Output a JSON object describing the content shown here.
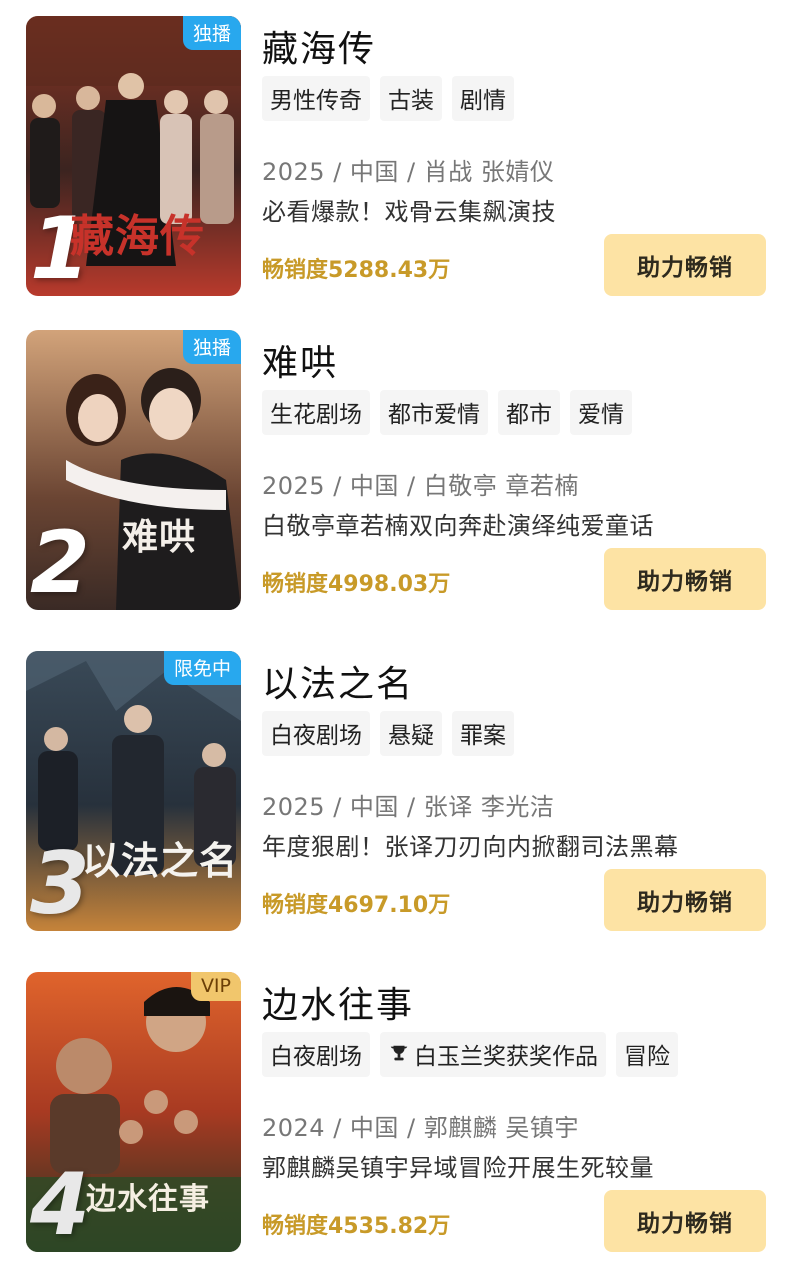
{
  "items": [
    {
      "rank": "1",
      "badge": "独播",
      "poster_title": "藏海传",
      "title": "藏海传",
      "tags": [
        "男性传奇",
        "古装",
        "剧情"
      ],
      "meta": "2025 / 中国 / 肖战 张婧仪",
      "desc": "必看爆款！戏骨云集飙演技",
      "sales": "畅销度5288.43万",
      "button": "助力畅销",
      "colors": {
        "bg_top": "#7b2f1f",
        "bg_bottom": "#3a1c14"
      }
    },
    {
      "rank": "2",
      "badge": "独播",
      "poster_title": "难哄",
      "title": "难哄",
      "tags": [
        "生花剧场",
        "都市爱情",
        "都市",
        "爱情"
      ],
      "meta": "2025 / 中国 / 白敬亭 章若楠",
      "desc": "白敬亭章若楠双向奔赴演绎纯爱童话",
      "sales": "畅销度4998.03万",
      "button": "助力畅销",
      "colors": {
        "bg_top": "#c49570",
        "bg_bottom": "#4b3026"
      }
    },
    {
      "rank": "3",
      "badge": "限免中",
      "poster_title": "以法之名",
      "title": "以法之名",
      "tags": [
        "白夜剧场",
        "悬疑",
        "罪案"
      ],
      "meta": "2025 / 中国 / 张译 李光洁",
      "desc": "年度狠剧！张译刀刃向内掀翻司法黑幕",
      "sales": "畅销度4697.10万",
      "button": "助力畅销",
      "colors": {
        "bg_top": "#3c4c5a",
        "bg_bottom": "#b87a3a"
      }
    },
    {
      "rank": "4",
      "badge": "VIP",
      "poster_title": "边水往事",
      "title": "边水往事",
      "tags": [
        "白夜剧场",
        "白玉兰奖获奖作品",
        "冒险"
      ],
      "meta": "2024 / 中国 / 郭麒麟 吴镇宇",
      "desc": "郭麒麟吴镇宇异域冒险开展生死较量",
      "sales": "畅销度4535.82万",
      "button": "助力畅销",
      "colors": {
        "bg_top": "#d5572a",
        "bg_bottom": "#2d3a24"
      }
    }
  ]
}
